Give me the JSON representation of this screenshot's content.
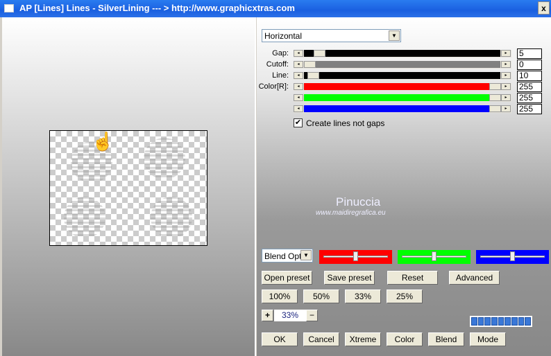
{
  "window": {
    "title": "AP [Lines]  Lines - SilverLining     --- > http://www.graphicxtras.com",
    "close_label": "x"
  },
  "mode_select": {
    "value": "Horizontal"
  },
  "sliders": [
    {
      "label": "Gap:",
      "value": "5",
      "color": "#000000",
      "level": 0.05
    },
    {
      "label": "Cutoff:",
      "value": "0",
      "color": "#808080",
      "level": 0.0
    },
    {
      "label": "Line:",
      "value": "10",
      "color": "#000000",
      "level": 0.02
    },
    {
      "label": "Color[R]:",
      "value": "255",
      "color": "#ff0000",
      "level": 1.0
    },
    {
      "label": "",
      "value": "255",
      "color": "#00ff00",
      "level": 1.0
    },
    {
      "label": "",
      "value": "255",
      "color": "#0000ff",
      "level": 1.0
    }
  ],
  "checkbox": {
    "label": "Create lines not gaps",
    "checked": true
  },
  "watermark": {
    "name": "Pinuccia",
    "url": "www.maidiregrafica.eu"
  },
  "blend_select": {
    "value": "Blend Opti"
  },
  "color_sliders": [
    {
      "color": "#ff0000",
      "level": 0.5
    },
    {
      "color": "#00ff00",
      "level": 0.5
    },
    {
      "color": "#0000ff",
      "level": 0.5
    }
  ],
  "buttons_row1": [
    "Open preset",
    "Save preset",
    "Reset",
    "Advanced"
  ],
  "zoom_buttons": [
    "100%",
    "50%",
    "33%",
    "25%"
  ],
  "zoom": {
    "plus": "+",
    "value": "33%",
    "minus": "−"
  },
  "bottom_buttons": [
    "OK",
    "Cancel",
    "Xtreme",
    "Color",
    "Blend",
    "Mode"
  ]
}
